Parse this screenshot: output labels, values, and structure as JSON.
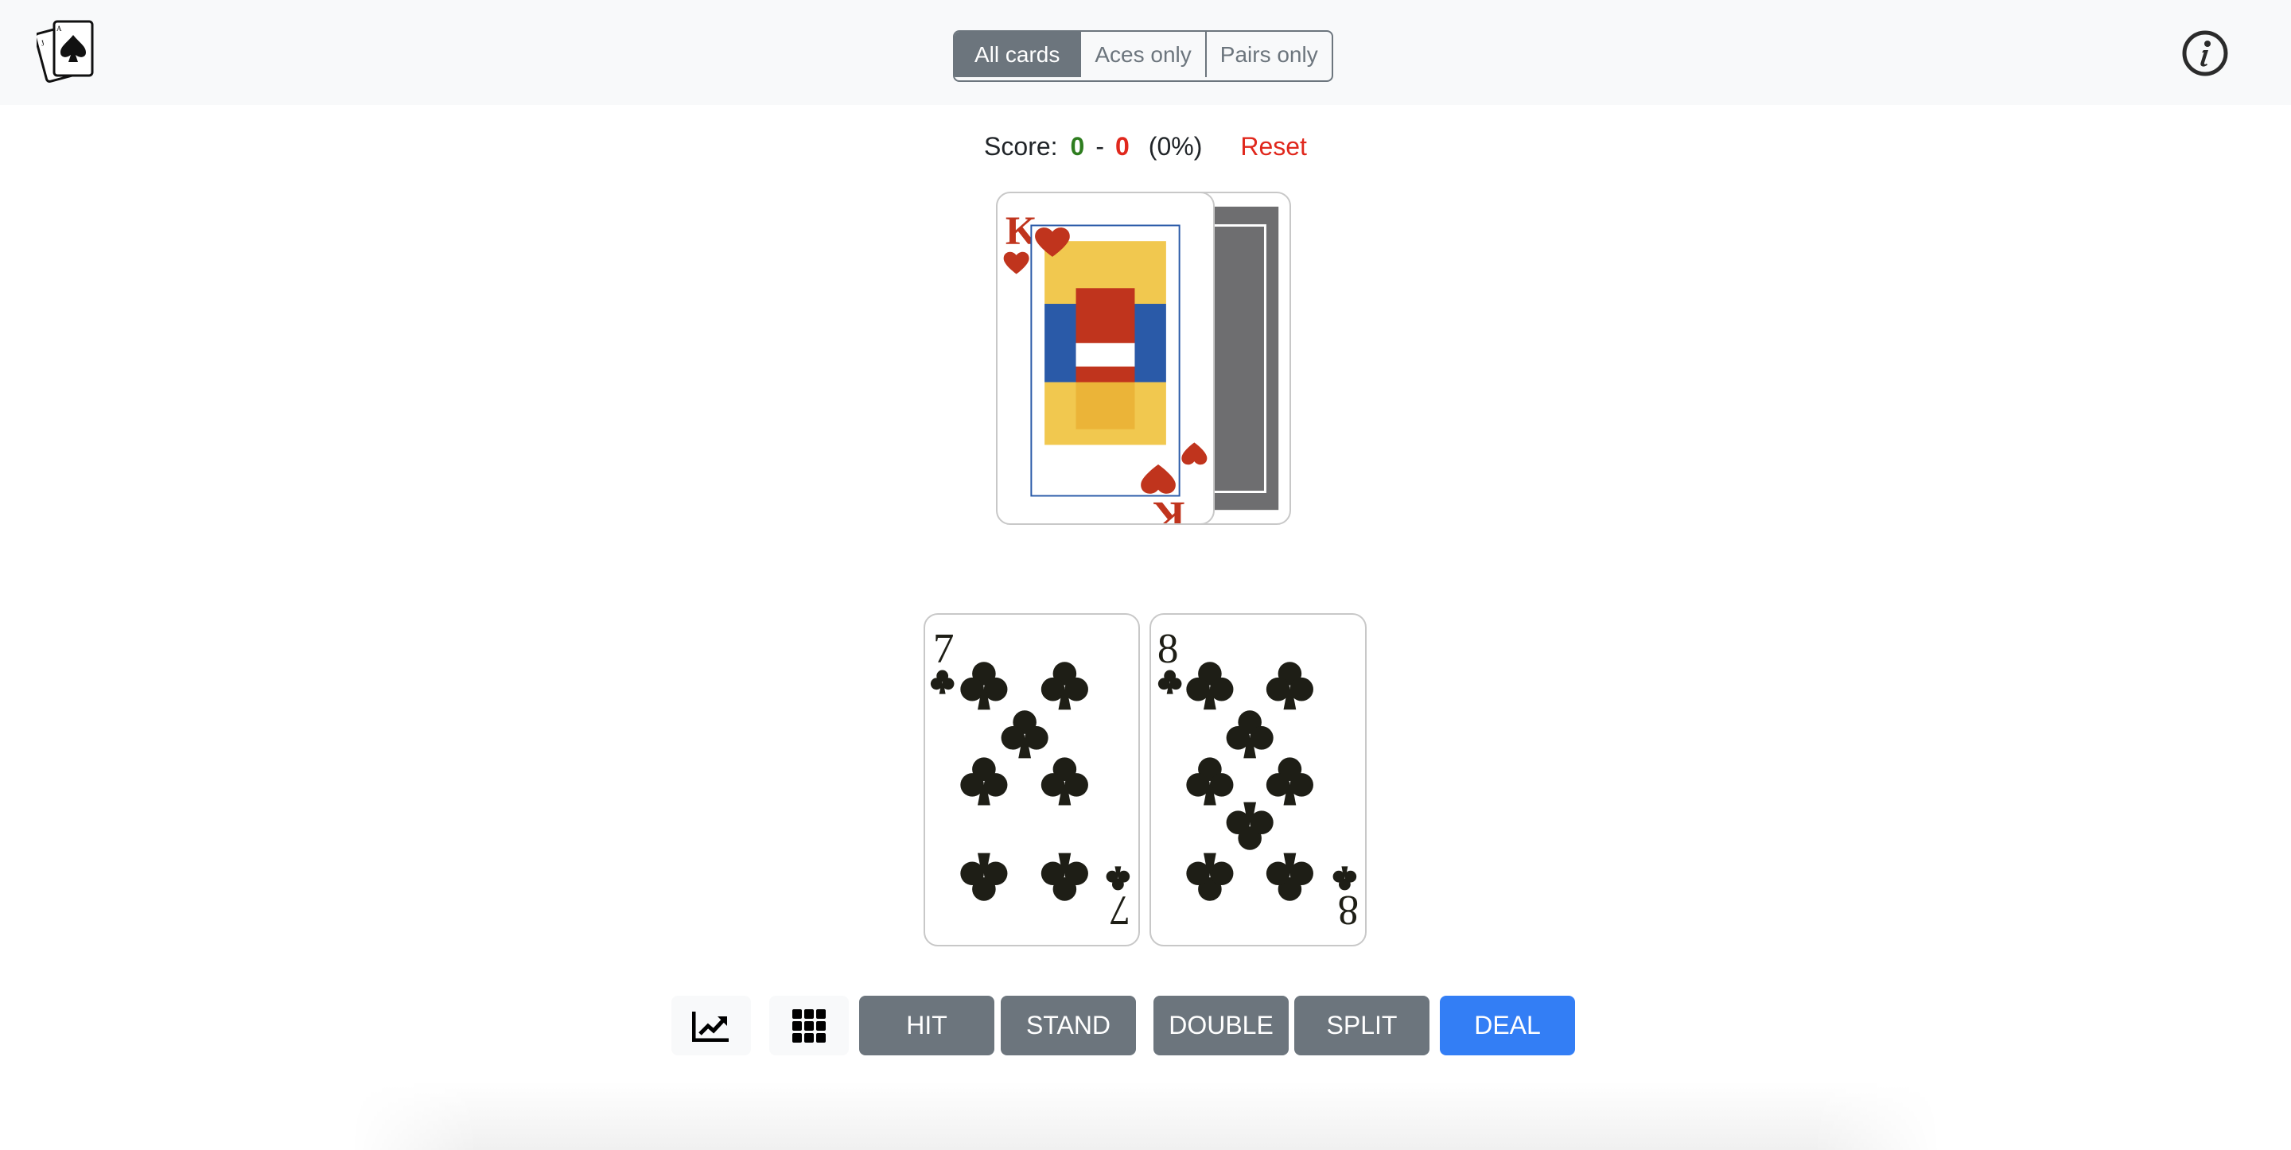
{
  "header": {
    "logo_icon": "playing-cards-icon",
    "filter_options": [
      {
        "label": "All cards",
        "active": true
      },
      {
        "label": "Aces only",
        "active": false
      },
      {
        "label": "Pairs only",
        "active": false
      }
    ],
    "info_icon": "info-circle-icon"
  },
  "score": {
    "label": "Score:",
    "wins": "0",
    "separator": "-",
    "losses": "0",
    "percent": "(0%)",
    "reset_label": "Reset",
    "colors": {
      "wins": "#2e7d1f",
      "losses": "#e0281d",
      "reset": "#e0281d"
    }
  },
  "dealer": {
    "cards": [
      {
        "rank": "K",
        "suit": "hearts",
        "face_up": true
      },
      {
        "rank": "",
        "suit": "",
        "face_up": false
      }
    ]
  },
  "player": {
    "cards": [
      {
        "rank": "7",
        "suit": "clubs",
        "face_up": true
      },
      {
        "rank": "8",
        "suit": "clubs",
        "face_up": true
      }
    ]
  },
  "actions": {
    "stats_icon": "chart-line-icon",
    "strategy_icon": "grid-icon",
    "hit": "HIT",
    "stand": "STAND",
    "double": "DOUBLE",
    "split": "SPLIT",
    "deal": "DEAL"
  },
  "colors": {
    "header_bg": "#f8f9fa",
    "secondary": "#6c757d",
    "primary": "#337ef5",
    "heart_red": "#c0341d",
    "club_black": "#1e1e16",
    "card_back": "#6e6e70"
  }
}
